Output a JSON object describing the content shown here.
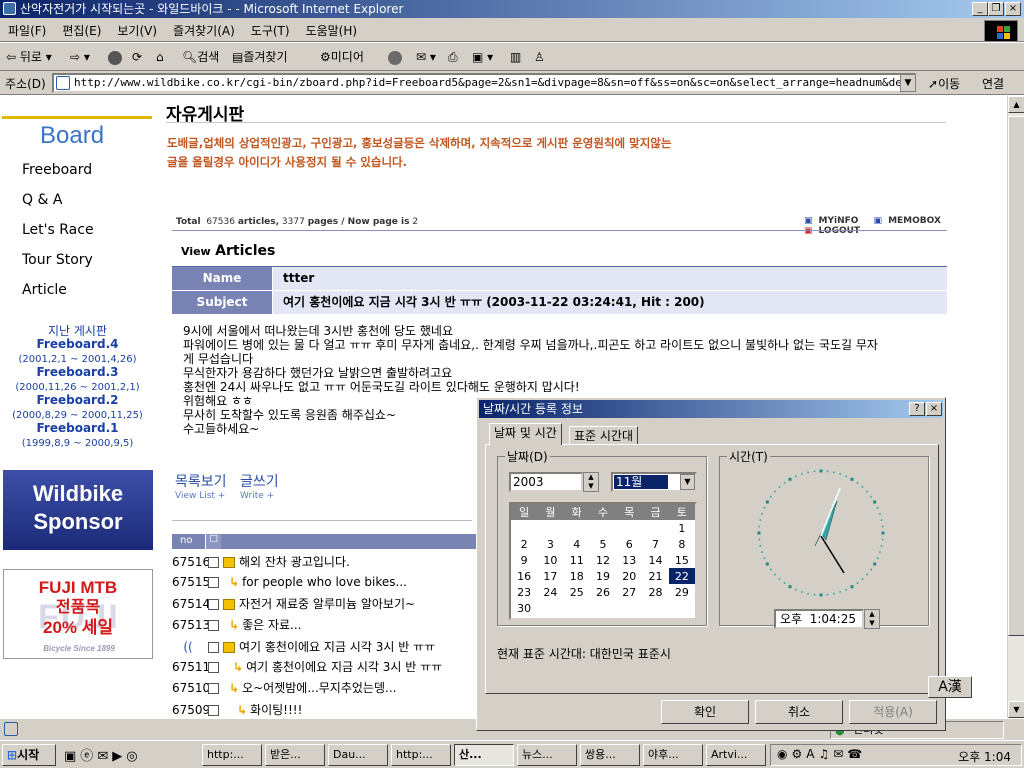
{
  "window": {
    "title": "산악자전거가 시작되는곳 - 와일드바이크 - - Microsoft Internet Explorer"
  },
  "menu": [
    "파일(F)",
    "편집(E)",
    "보기(V)",
    "즐겨찾기(A)",
    "도구(T)",
    "도움말(H)"
  ],
  "toolbar": {
    "back": "뒤로",
    "search": "검색",
    "favorites": "즐겨찾기",
    "media": "미디어"
  },
  "address": {
    "label": "주소(D)",
    "url": "http://www.wildbike.co.kr/cgi-bin/zboard.php?id=Freeboard5&page=2&sn1=&divpage=8&sn=off&ss=on&sc=on&select_arrange=headnum&desc=as",
    "go": "이동",
    "links": "연결"
  },
  "sidebar": {
    "title": "Board",
    "items": [
      "Freeboard",
      "Q & A",
      "Let's Race",
      "Tour Story",
      "Article"
    ],
    "old_title": "지난 게시판",
    "old": [
      {
        "name": "Freeboard.4",
        "range": "(2001,2,1 ~ 2001,4,26)"
      },
      {
        "name": "Freeboard.3",
        "range": "(2000,11,26 ~ 2001,2,1)"
      },
      {
        "name": "Freeboard.2",
        "range": "(2000,8,29 ~ 2000,11,25)"
      },
      {
        "name": "Freeboard.1",
        "range": "(1999,8,9 ~ 2000,9,5)"
      }
    ],
    "banner1": [
      "Wildbike",
      "Sponsor"
    ],
    "banner2": {
      "line1": "FUJI MTB",
      "line2": "전품목",
      "line3": "20% 세일",
      "brand": "FUJI",
      "tagline": "Bicycle Since 1899"
    }
  },
  "board": {
    "title": "자유게시판",
    "notice": [
      "도배글,업체의 상업적인광고, 구인광고, 홍보성글등은 삭제하며, 지속적으로 게시판 운영원칙에 맞지않는",
      "글을 올릴경우 아이디가 사용정지 될 수 있습니다."
    ],
    "total_label": "Total",
    "total": "67536",
    "articles_label": "articles,",
    "pages": "3377",
    "pages_label": "pages / Now page is",
    "now_page": "2",
    "links": [
      "MYiNFO",
      "MEMOBOX",
      "LOGOUT"
    ],
    "view_prefix": "View",
    "view_label": "Articles",
    "name_label": "Name",
    "name_value": "ttter",
    "subject_label": "Subject",
    "subject_value": "여기 홍천이에요 지금 시각 3시 반 ㅠㅠ (2003-11-22 03:24:41, Hit : 200)",
    "body": [
      "9시에 서울에서 떠나왔는데 3시반 홍천에 당도 했네요",
      "파워에이드 병에 있는 물 다 얼고 ㅠㅠ 후미 무자게 춥네요,. 한계령 우찌 넘을까나,.피곤도 하고 라이트도 없으니 불빛하나 없는 국도길 무자",
      "게 무섭습니다",
      "무식한자가 용감하다 했던가요 날밝으면 출발하려고요",
      "홍천엔 24시 싸우나도 없고 ㅠㅠ 어둔국도길 라이트 있다해도 운행하지 맙시다!",
      "위험해요 ㅎㅎ",
      "무사히 도착할수 있도록 응원좀 해주십쇼~",
      "수고들하세요~"
    ],
    "list_btn": "목록보기",
    "list_sub": "View List +",
    "write_btn": "글쓰기",
    "write_sub": "Write +",
    "list_header_no": "no",
    "rows": [
      {
        "no": "67516",
        "title": "해외 잔차 광고입니다.",
        "type": "folder"
      },
      {
        "no": "67515",
        "title": "for people who love bikes...",
        "type": "reply"
      },
      {
        "no": "67514",
        "title": "자전거 재료중 알루미늄 알아보기~",
        "type": "folder"
      },
      {
        "no": "67513",
        "title": "좋은 자료...",
        "type": "reply"
      },
      {
        "no": "",
        "title": "여기 홍천이에요 지금 시각 3시 반 ㅠㅠ",
        "type": "current"
      },
      {
        "no": "67511",
        "title": "여기 홍천이에요 지금 시각 3시 반 ㅠㅠ",
        "type": "reply"
      },
      {
        "no": "67510",
        "title": "오~어젯밤에...무지추었는뎅...",
        "type": "reply"
      },
      {
        "no": "67509",
        "title": "화이팅!!!!",
        "type": "reply2"
      }
    ]
  },
  "dialog": {
    "title": "날짜/시간 등록 정보",
    "tabs": [
      "날짜 및 시간",
      "표준 시간대"
    ],
    "date_group": "날짜(D)",
    "time_group": "시간(T)",
    "year": "2003",
    "month": "11월",
    "weekdays": [
      "일",
      "월",
      "화",
      "수",
      "목",
      "금",
      "토"
    ],
    "days": [
      "1",
      "2",
      "3",
      "4",
      "5",
      "6",
      "7",
      "8",
      "9",
      "10",
      "11",
      "12",
      "13",
      "14",
      "15",
      "16",
      "17",
      "18",
      "19",
      "20",
      "21",
      "22",
      "23",
      "24",
      "25",
      "26",
      "27",
      "28",
      "29",
      "30"
    ],
    "selected_day": "22",
    "time": "오후  1:04:25",
    "timezone": "현재 표준 시간대: 대한민국 표준시",
    "ok": "확인",
    "cancel": "취소",
    "apply": "적용(A)"
  },
  "ime": "A漢",
  "statusbar": {
    "zone": "인터넷"
  },
  "taskbar": {
    "start": "시작",
    "tasks": [
      "http:...",
      "받은...",
      "Dau...",
      "http:...",
      "산...",
      "뉴스...",
      "쌍용...",
      "야후...",
      "Artvi..."
    ],
    "clock": "오후 1:04"
  }
}
